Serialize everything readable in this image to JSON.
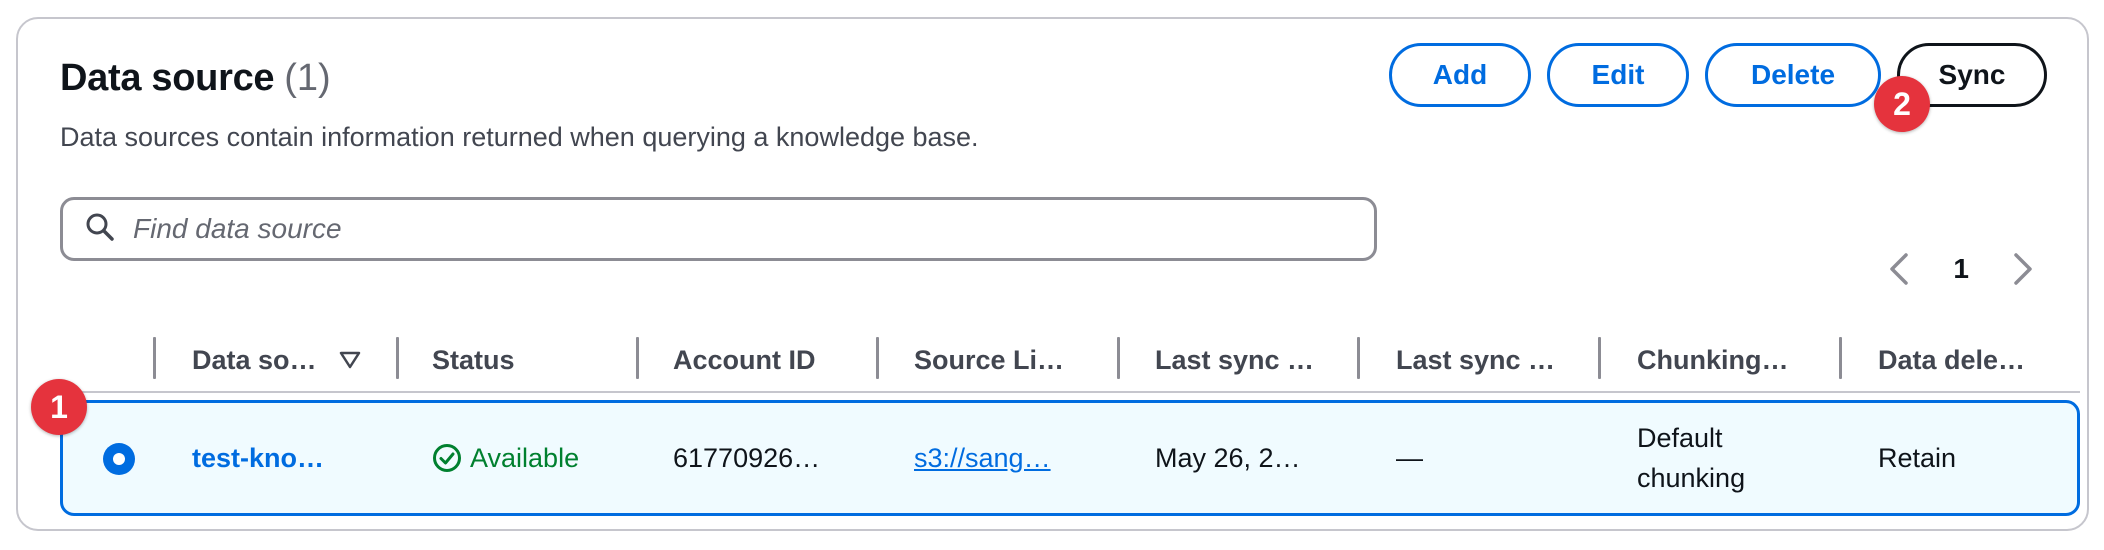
{
  "header": {
    "title": "Data source",
    "count": "(1)",
    "description": "Data sources contain information returned when querying a knowledge base."
  },
  "actions": {
    "add_label": "Add",
    "edit_label": "Edit",
    "delete_label": "Delete",
    "sync_label": "Sync"
  },
  "search": {
    "placeholder": "Find data source",
    "value": ""
  },
  "pagination": {
    "current_page": "1"
  },
  "table": {
    "columns": [
      "Data so…",
      "Status",
      "Account ID",
      "Source Li…",
      "Last sync …",
      "Last sync …",
      "Chunking…",
      "Data dele…"
    ],
    "rows": [
      {
        "name": "test-kno…",
        "status": "Available",
        "account_id": "61770926…",
        "source_link": "s3://sang…",
        "last_sync_time": "May 26, 2…",
        "last_sync_warnings": "—",
        "chunking_line1": "Default",
        "chunking_line2": "chunking",
        "data_deletion": "Retain",
        "selected": true
      }
    ]
  },
  "annotations": {
    "badge_1": "1",
    "badge_2": "2"
  },
  "colors": {
    "accent": "#006ce0",
    "success": "#00802f",
    "badge": "#e5333d",
    "row_selected_bg": "#f0fbff"
  }
}
